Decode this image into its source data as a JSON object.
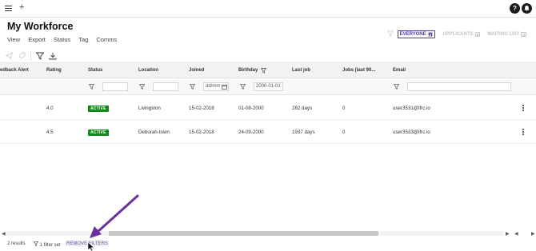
{
  "topbar": {
    "menu_icon": "hamburger-icon",
    "add_icon": "plus-icon",
    "add_label": "+",
    "help_label": "?",
    "notify_icon": "bell-icon"
  },
  "page": {
    "title": "My Workforce"
  },
  "nav": {
    "items": [
      "View",
      "Export",
      "Status",
      "Tag",
      "Comms"
    ]
  },
  "tabs": [
    {
      "label": "EVERYONE",
      "count": "2",
      "active": true
    },
    {
      "label": "APPLICANTS",
      "count": "0",
      "active": false
    },
    {
      "label": "WAITING LIST",
      "count": "0",
      "active": false
    }
  ],
  "toolbar": {
    "icons": [
      "send-icon",
      "tag-icon",
      "filter-icon",
      "download-icon"
    ]
  },
  "table": {
    "columns": [
      "edback Alert",
      "Rating",
      "Status",
      "Location",
      "Joined",
      "Birthday",
      "Last job",
      "Jobs (last 90...",
      "Email"
    ],
    "filters": {
      "joined_placeholder": "dd/mm",
      "birthday_value": "2000-01-01 -"
    },
    "rows": [
      {
        "rating": "4.0",
        "status": "ACTIVE",
        "location": "Livingston",
        "joined": "15-02-2018",
        "birthday": "01-08-2000",
        "last_job": "282 days",
        "jobs": "0",
        "email": "user3531@lfrc.io"
      },
      {
        "rating": "4.5",
        "status": "ACTIVE",
        "location": "Deborah-town",
        "joined": "15-02-2018",
        "birthday": "24-09-2000",
        "last_job": "1937 days",
        "jobs": "0",
        "email": "user3533@lfrc.io"
      }
    ]
  },
  "footer": {
    "results": "2 results",
    "filter_set": "1 filter set",
    "remove_filters": "REMOVE FILTERS"
  },
  "colors": {
    "accent": "#4b3f9c",
    "active_status": "#148a1a",
    "annotation_arrow": "#6a2fa0"
  }
}
